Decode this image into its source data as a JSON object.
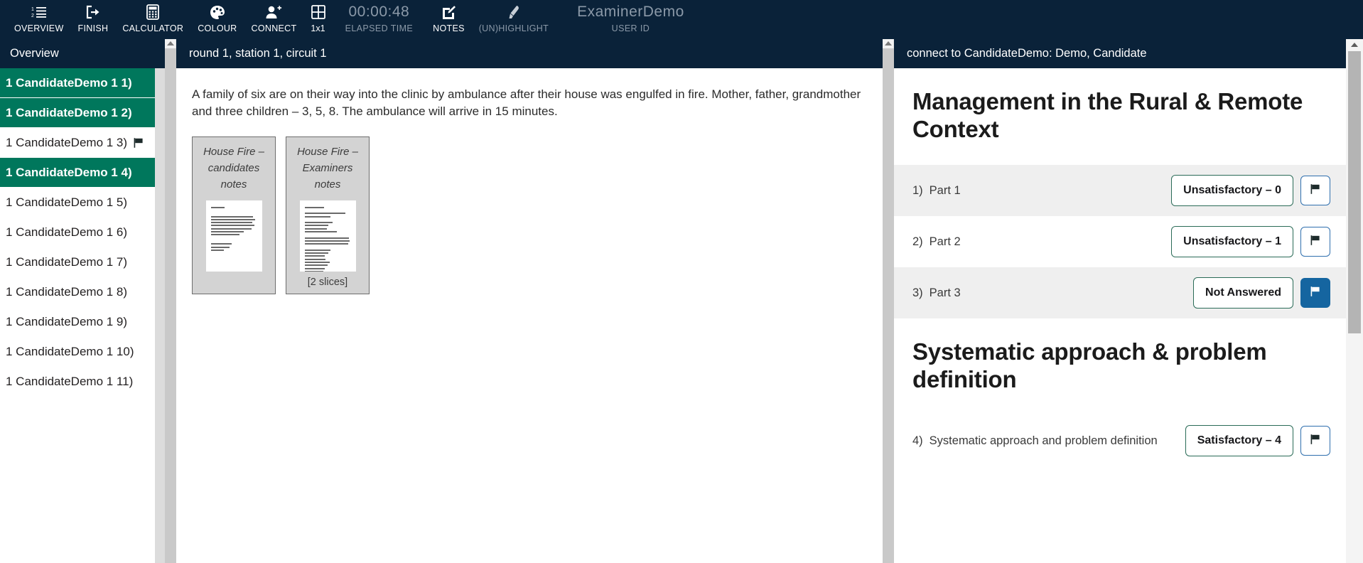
{
  "toolbar": {
    "items": [
      {
        "icon": "ordered-list-icon",
        "label": "OVERVIEW"
      },
      {
        "icon": "logout-icon",
        "label": "FINISH"
      },
      {
        "icon": "calculator-icon",
        "label": "CALCULATOR"
      },
      {
        "icon": "palette-icon",
        "label": "COLOUR"
      },
      {
        "icon": "add-person-icon",
        "label": "CONNECT"
      },
      {
        "icon": "grid-icon",
        "label": "1x1"
      }
    ],
    "timer": {
      "value": "00:00:48",
      "label": "ELAPSED TIME"
    },
    "notes": {
      "icon": "notes-pencil-icon",
      "label": "NOTES"
    },
    "highlight": {
      "icon": "highlighter-icon",
      "label": "(UN)HIGHLIGHT"
    },
    "user": {
      "name": "ExaminerDemo",
      "label": "USER ID"
    }
  },
  "sidebar": {
    "header": "Overview",
    "items": [
      {
        "label": "1 CandidateDemo 1  1)",
        "selected": true,
        "flag": false
      },
      {
        "label": "1 CandidateDemo 1  2)",
        "selected": true,
        "flag": false
      },
      {
        "label": "1 CandidateDemo 1  3)",
        "selected": false,
        "flag": true
      },
      {
        "label": "1 CandidateDemo 1  4)",
        "selected": true,
        "flag": false
      },
      {
        "label": "1 CandidateDemo 1  5)",
        "selected": false,
        "flag": false
      },
      {
        "label": "1 CandidateDemo 1  6)",
        "selected": false,
        "flag": false
      },
      {
        "label": "1 CandidateDemo 1  7)",
        "selected": false,
        "flag": false
      },
      {
        "label": "1 CandidateDemo 1  8)",
        "selected": false,
        "flag": false
      },
      {
        "label": "1 CandidateDemo 1  9)",
        "selected": false,
        "flag": false
      },
      {
        "label": "1 CandidateDemo 1  10)",
        "selected": false,
        "flag": false
      },
      {
        "label": "1 CandidateDemo 1  11)",
        "selected": false,
        "flag": false
      }
    ]
  },
  "center": {
    "header": "round 1, station 1, circuit 1",
    "stem": "A family of six are on their way into the clinic by ambulance after their house was engulfed in fire. Mother, father, grandmother and three children – 3, 5, 8. The ambulance will arrive in 15 minutes.",
    "thumbnails": [
      {
        "title": "House Fire – candidates notes",
        "slices": ""
      },
      {
        "title": "House Fire – Examiners notes",
        "slices": "[2 slices]"
      }
    ]
  },
  "right": {
    "header": "connect to CandidateDemo: Demo, Candidate",
    "sections": [
      {
        "title": "Management in the Rural & Remote Context",
        "questions": [
          {
            "num": "1)",
            "text": "Part 1",
            "grade": "Unsatisfactory – 0",
            "flagged": false
          },
          {
            "num": "2)",
            "text": "Part 2",
            "grade": "Unsatisfactory – 1",
            "flagged": false
          },
          {
            "num": "3)",
            "text": "Part 3",
            "grade": "Not Answered",
            "flagged": true
          }
        ]
      },
      {
        "title": "Systematic approach & problem definition",
        "questions": [
          {
            "num": "4)",
            "text": "Systematic approach and problem definition",
            "grade": "Satisfactory – 4",
            "flagged": false
          }
        ]
      }
    ]
  },
  "colors": {
    "navy": "#0a2239",
    "green": "#00775c",
    "blue": "#1565a0",
    "grey_row": "#efefef"
  }
}
